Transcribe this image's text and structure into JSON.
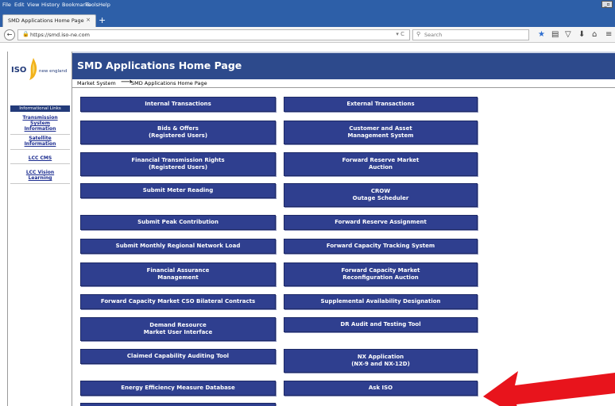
{
  "browser": {
    "menu": [
      "File",
      "Edit",
      "View",
      "History",
      "Bookmarks",
      "Tools",
      "Help"
    ],
    "tab_title": "SMD Applications Home Page",
    "tab_close": "×",
    "new_tab": "+",
    "back": "←",
    "url": "https://smd.iso-ne.com",
    "reload": "▾  C",
    "search_placeholder": "Search",
    "window_ctrl": "_▫",
    "toolbar_icons": [
      "★",
      "▤",
      "▽",
      "⬇",
      "⌂",
      "≡"
    ]
  },
  "logo": {
    "iso": "ISO",
    "ne": "new england"
  },
  "sidebar": {
    "heading": "Informational Links",
    "links": [
      "Transmission\nSystem\nInformation",
      "Satellite\nInformation",
      "LCC CMS",
      "LCC Vision\nLearning"
    ]
  },
  "page": {
    "title": "SMD Applications Home Page",
    "breadcrumb_1": "Market System",
    "breadcrumb_arrow": "⟶",
    "breadcrumb_2": "SMD Applications Home Page"
  },
  "apps": {
    "left": [
      "Internal Transactions",
      "Bids & Offers\n(Registered Users)",
      "Financial Transmission Rights\n(Registered Users)",
      "Submit Meter Reading",
      "Submit Peak Contribution",
      "Submit Monthly Regional Network Load",
      "Financial Assurance\nManagement",
      "Forward Capacity Market CSO Bilateral Contracts",
      "Demand Resource\nMarket User Interface",
      "Claimed Capability Auditing Tool",
      "Energy Efficiency Measure Database",
      ""
    ],
    "right": [
      "External Transactions",
      "Customer and Asset\nManagement System",
      "Forward Reserve Market\nAuction",
      "CROW\nOutage Scheduler",
      "Forward Reserve Assignment",
      "Forward Capacity Tracking System",
      "Forward Capacity Market\nReconfiguration Auction",
      "Supplemental Availability Designation",
      "DR Audit and Testing Tool",
      "NX Application\n(NX-9 and NX-12D)",
      "Ask ISO"
    ]
  },
  "colors": {
    "banner": "#2d4a8c",
    "button": "#2f3f8f",
    "arrow": "#e8141c",
    "chrome": "#2d5fa8"
  }
}
